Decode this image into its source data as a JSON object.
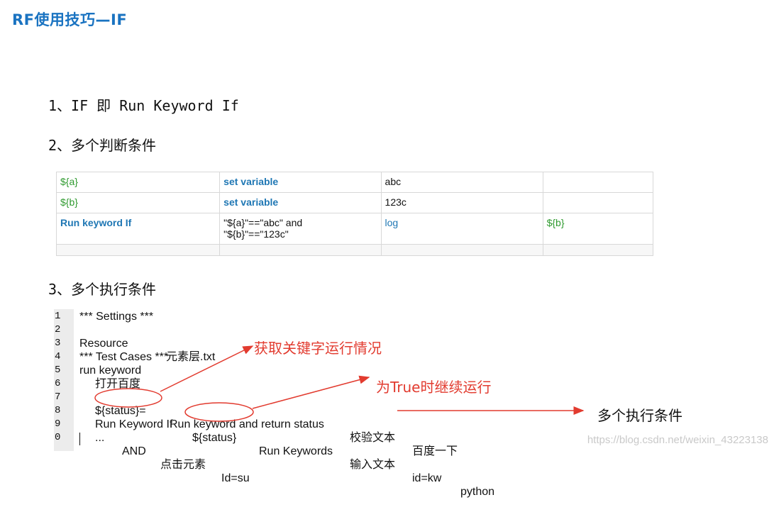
{
  "title": "RF使用技巧—IF",
  "headings": {
    "h1": "1、IF 即 Run Keyword If",
    "h2": "2、多个判断条件",
    "h3": "3、多个执行条件"
  },
  "table": {
    "rows": [
      {
        "c1": "${a}",
        "c2": "set variable",
        "c3": "abc",
        "c4": ""
      },
      {
        "c1": "${b}",
        "c2": "set variable",
        "c3": "123c",
        "c4": ""
      },
      {
        "c1": "Run keyword If",
        "c2_line1": "\"${a}\"==\"abc\" and",
        "c2_line2": "\"${b}\"==\"123c\"",
        "c3": "log",
        "c4": "${b}"
      }
    ]
  },
  "code": {
    "line_numbers": [
      "1",
      "2",
      "3",
      "4",
      "5",
      "6",
      "7",
      "8",
      "9",
      "0"
    ],
    "l1": "*** Settings ***",
    "l2a": "Resource",
    "l2b": "元素层.txt",
    "l4": "*** Test Cases ***",
    "l5": "run keyword",
    "l6": "打开百度",
    "l7a": "${status}=",
    "l7b": "Run keyword and return status",
    "l7c": "校验文本",
    "l7d": "百度一下",
    "l8a": "Run Keyword If",
    "l8b": "${status}",
    "l8c": "Run Keywords",
    "l8d": "输入文本",
    "l8e": "id=kw",
    "l8f": "python",
    "l9a": "...",
    "l9b": "AND",
    "l9c": "点击元素",
    "l9d": "Id=su"
  },
  "annotations": {
    "note1": "获取关键字运行情况",
    "note2": "为True时继续运行",
    "note3": "多个执行条件"
  },
  "colors": {
    "title": "#1a73c1",
    "variable": "#2f9a2f",
    "keyword": "#1f77b4",
    "annotation": "#e23b2f"
  },
  "watermark": "https://blog.csdn.net/weixin_43223138"
}
